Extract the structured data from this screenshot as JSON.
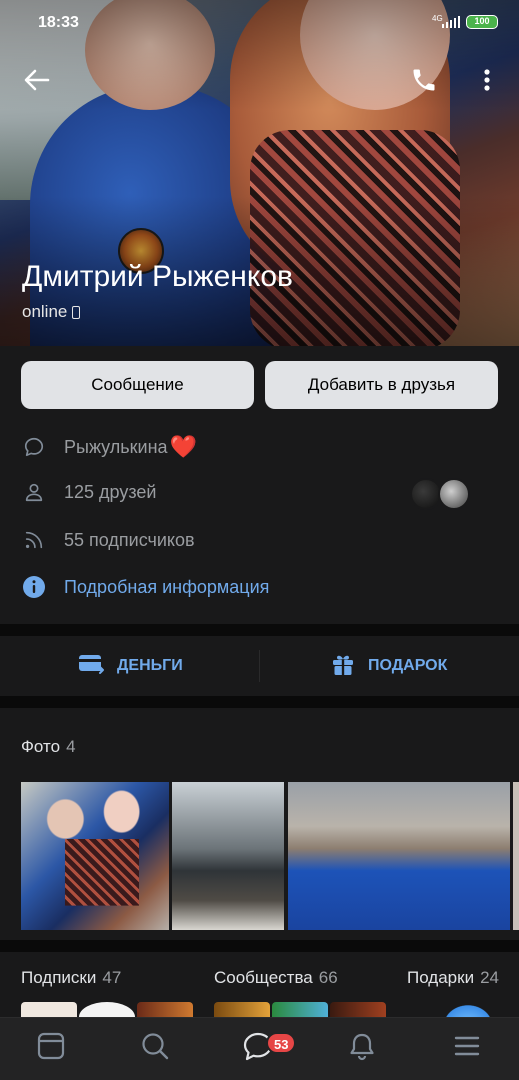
{
  "status_bar": {
    "time": "18:33",
    "network": "4G",
    "battery": "100"
  },
  "profile": {
    "name": "Дмитрий Рыженков",
    "online": "online",
    "buttons": {
      "message": "Сообщение",
      "add_friend": "Добавить в друзья"
    },
    "status": "Рыжулькина",
    "status_emoji": "❤️",
    "friends": "125 друзей",
    "followers": "55 подписчиков",
    "details_link": "Подробная информация"
  },
  "actions": {
    "money": "ДЕНЬГИ",
    "gift": "ПОДАРОК"
  },
  "photos": {
    "title": "Фото",
    "count": "4"
  },
  "sections": [
    {
      "title": "Подписки",
      "count": "47"
    },
    {
      "title": "Сообщества",
      "count": "66"
    },
    {
      "title": "Подарки",
      "count": "24"
    }
  ],
  "tabbar": {
    "messages_badge": "53"
  },
  "colors": {
    "accent": "#71aaeb",
    "background": "#0a0a0a",
    "card": "#19191a",
    "badge": "#e64646"
  }
}
